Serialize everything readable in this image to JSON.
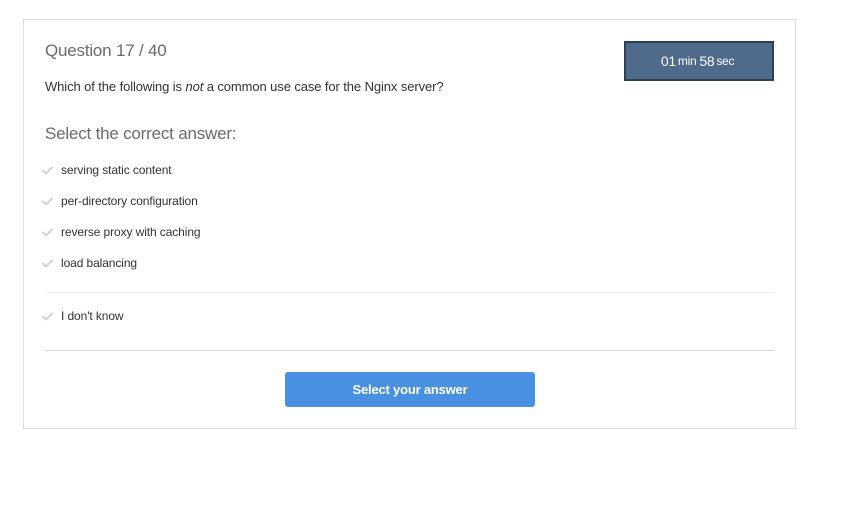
{
  "header": {
    "question_counter": "Question 17 / 40"
  },
  "timer": {
    "minutes": "01",
    "min_label": "min",
    "seconds": "58",
    "sec_label": "sec"
  },
  "question": {
    "before": "Which of the following is ",
    "emphasis": "not",
    "after": " a common use case for the Nginx server?"
  },
  "answers": {
    "heading": "Select the correct answer:",
    "options": [
      {
        "label": "serving static content"
      },
      {
        "label": "per-directory configuration"
      },
      {
        "label": "reverse proxy with caching"
      },
      {
        "label": "load balancing"
      }
    ],
    "dont_know": "I don't know"
  },
  "submit": {
    "label": "Select your answer"
  },
  "colors": {
    "timer_bg": "#4f6a8a",
    "submit_bg": "#4a90e2",
    "check_color": "#d4d4d4"
  }
}
